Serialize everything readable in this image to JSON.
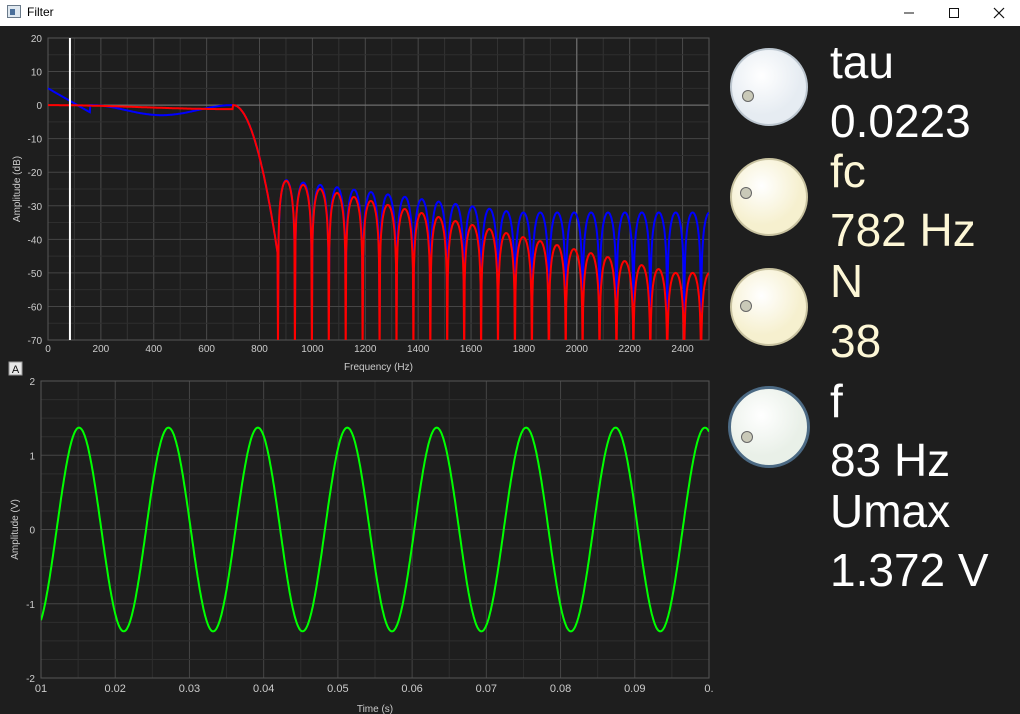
{
  "window": {
    "title": "Filter",
    "minimize_icon": "minimize-icon",
    "maximize_icon": "maximize-icon",
    "close_icon": "close-icon"
  },
  "controls": [
    {
      "label": "tau",
      "value": "0.0223",
      "knob_color": "#e6ecf2",
      "knob_level": 0.08
    },
    {
      "label": "fc",
      "value": "782 Hz",
      "knob_color": "#f6f0cf",
      "knob_level": 0.2
    },
    {
      "label": "N",
      "value": "38",
      "knob_color": "#f6f0cf",
      "knob_level": 0.18
    },
    {
      "label": "f",
      "value": "83 Hz",
      "knob_color": "#e9f0e8",
      "knob_level": 0.08
    }
  ],
  "readout": {
    "label": "Umax",
    "value": "1.372 V"
  },
  "freq_plot": {
    "xlabel": "Frequency (Hz)",
    "ylabel": "Amplitude (dB)",
    "xticks": [
      "200",
      "400",
      "600",
      "800",
      "1000",
      "1200",
      "1400",
      "1600",
      "1800",
      "2000",
      "2200",
      "2400"
    ],
    "yticks": [
      "20",
      "10",
      "0",
      "-10",
      "-20",
      "-30",
      "-40",
      "-50",
      "-60",
      "-70"
    ],
    "first_xtick": "0",
    "marker_frequency_hz": 83,
    "series_colors": {
      "blue": "#0000ff",
      "red": "#ff0000"
    }
  },
  "time_plot": {
    "xlabel": "Time (s)",
    "ylabel": "Amplitude (V)",
    "xticks": [
      "01",
      "0.02",
      "0.03",
      "0.04",
      "0.05",
      "0.06",
      "0.07",
      "0.08",
      "0.09",
      "0."
    ],
    "yticks": [
      "2",
      "1",
      "0",
      "-1",
      "-2"
    ],
    "autoscale_label": "A",
    "series_color": "#00ff00"
  },
  "chart_data": [
    {
      "type": "line",
      "xlabel": "Frequency (Hz)",
      "ylabel": "Amplitude (dB)",
      "xlim": [
        0,
        2500
      ],
      "ylim": [
        -70,
        20
      ],
      "grid": true,
      "series": [
        {
          "color": "#0000ff",
          "x": [
            0,
            100,
            200,
            400,
            600,
            700,
            800,
            870,
            900,
            1000,
            1100,
            1200,
            1300,
            1400,
            1500,
            1600,
            1700,
            1800,
            1900,
            2000,
            2100,
            2200,
            2300,
            2400,
            2500
          ],
          "y": [
            5,
            1,
            -2,
            0,
            0,
            0,
            -15,
            -40,
            -23,
            -28,
            -28,
            -29,
            -31,
            -32,
            -33,
            -34,
            -34,
            -34,
            -35,
            -35,
            -35,
            -35,
            -35,
            -35,
            -50
          ]
        },
        {
          "color": "#ff0000",
          "x": [
            0,
            100,
            200,
            400,
            600,
            700,
            800,
            870,
            900,
            1000,
            1100,
            1200,
            1300,
            1400,
            1500,
            1600,
            1700,
            1800,
            1900,
            2000,
            2100,
            2200,
            2300,
            2400,
            2500
          ],
          "y": [
            -1,
            0,
            0,
            0,
            0,
            0,
            -15,
            -45,
            -23,
            -28,
            -32,
            -35,
            -38,
            -40,
            -42,
            -44,
            -46,
            -48,
            -49,
            -50,
            -51,
            -52,
            -53,
            -53,
            -70
          ]
        }
      ]
    },
    {
      "type": "line",
      "xlabel": "Time (s)",
      "ylabel": "Amplitude (V)",
      "xlim": [
        0.01,
        0.1
      ],
      "ylim": [
        -2,
        2
      ],
      "grid": true,
      "series": [
        {
          "color": "#00ff00",
          "amplitude": 1.372,
          "frequency_hz": 83
        }
      ]
    }
  ]
}
